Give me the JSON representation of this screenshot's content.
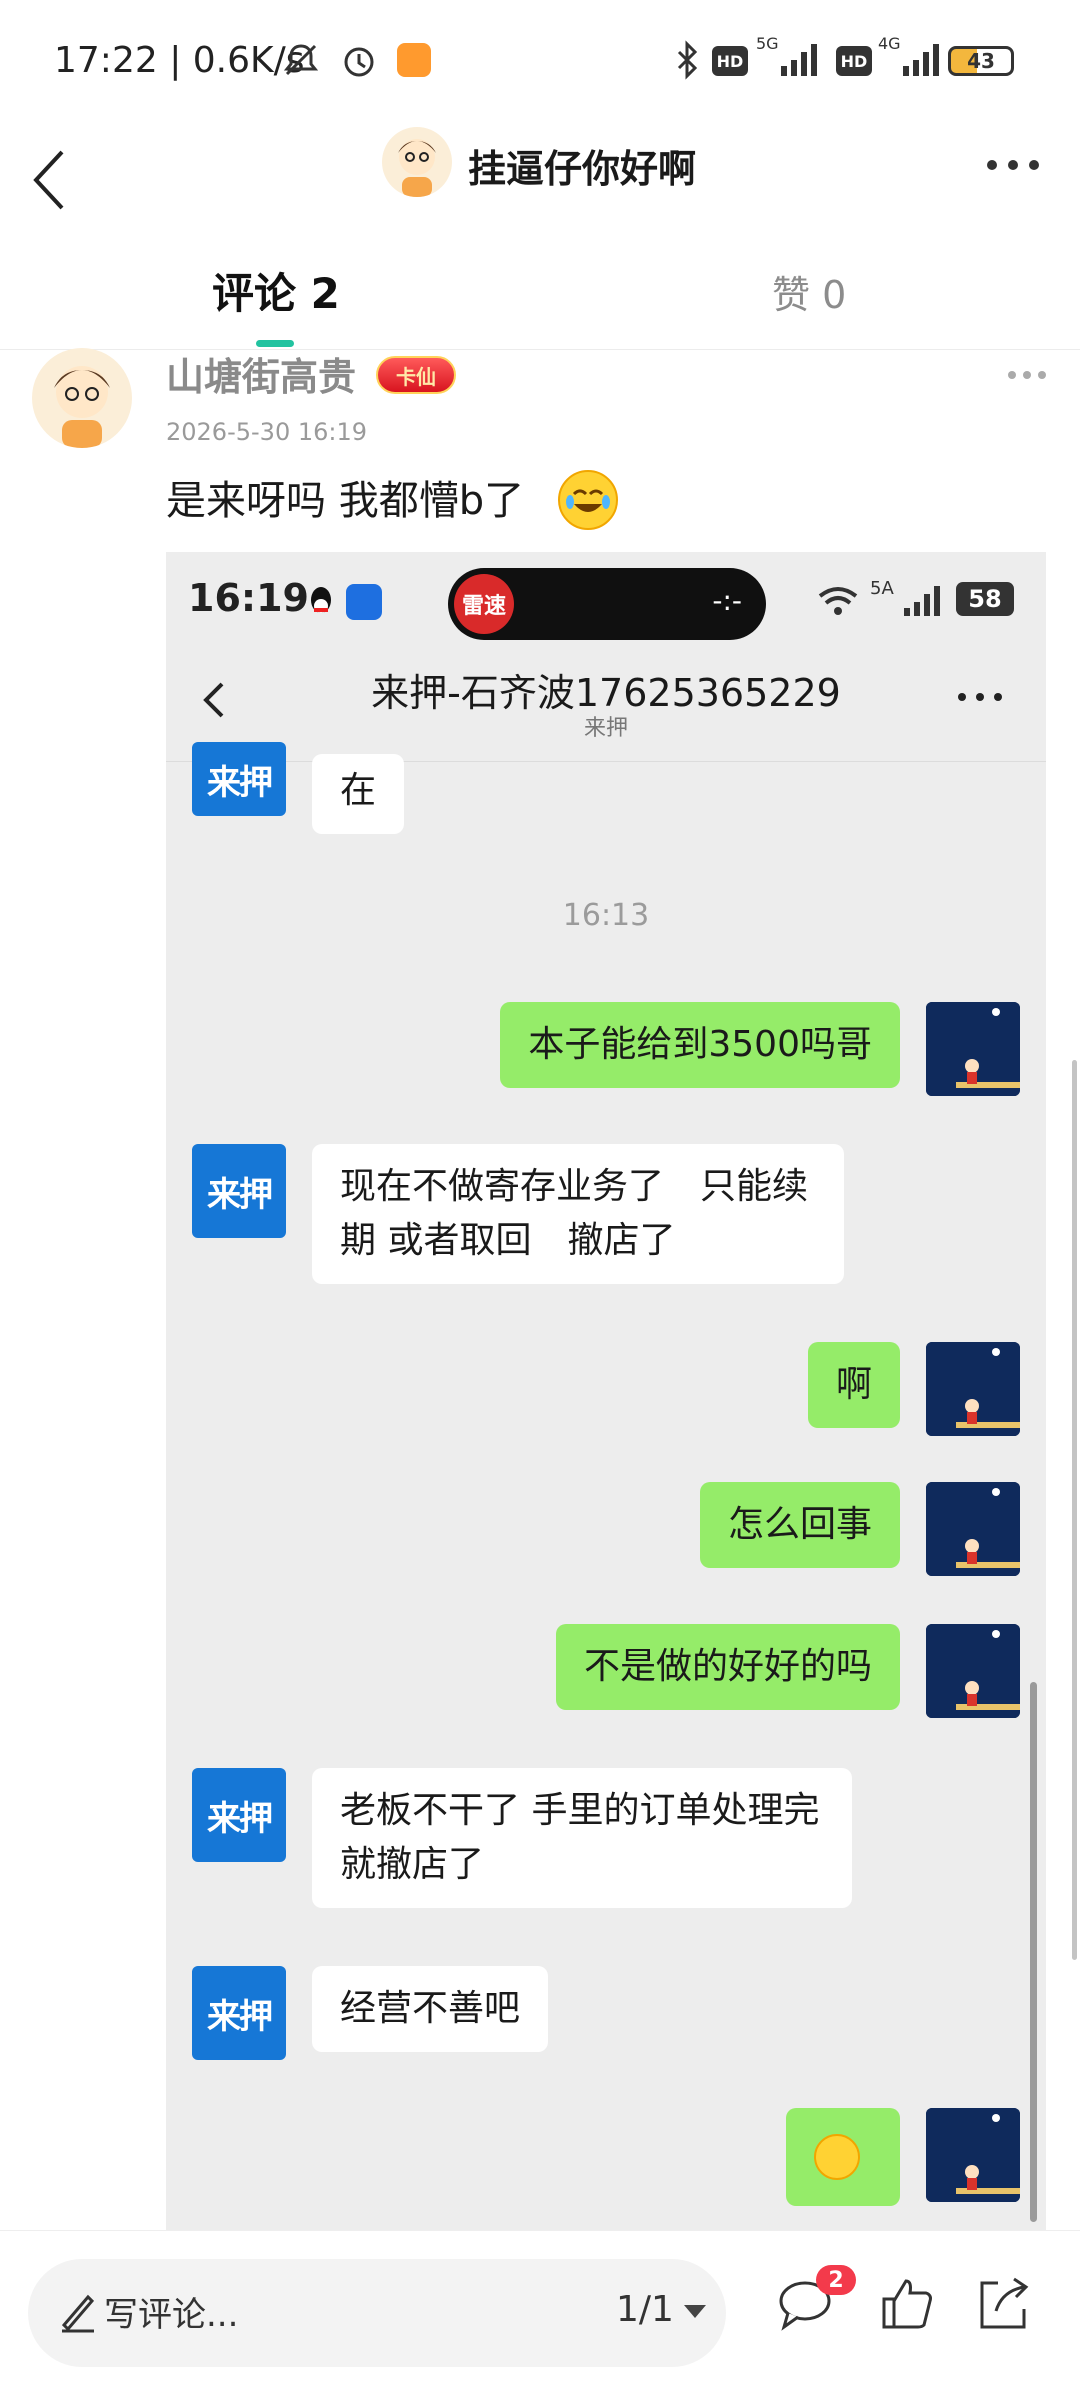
{
  "status_bar": {
    "time": "17:22 | 0.6K/s",
    "battery": "43",
    "net_5g": "5G",
    "net_4g": "4G",
    "hd1": "HD",
    "hd2": "HD"
  },
  "header": {
    "title": "挂逼仔你好啊"
  },
  "tabs": {
    "comments": "评论 2",
    "likes": "赞 0"
  },
  "comment": {
    "username": "山塘街高贵",
    "badge": "卡仙",
    "date": "2026-5-30 16:19",
    "text": "是来呀吗 我都懵b了"
  },
  "screenshot": {
    "status_time": "16:19",
    "island_badge": "雷速",
    "island_text": "-:-",
    "net": "5A",
    "battery": "58",
    "title": "来押-石齐波17625365229",
    "subtitle": "来押",
    "avatar_left_label": "来押",
    "messages": [
      {
        "side": "left",
        "text": "在"
      },
      {
        "side": "time",
        "text": "16:13"
      },
      {
        "side": "right",
        "text": "本子能给到3500吗哥"
      },
      {
        "side": "left",
        "text": "现在不做寄存业务了　只能续期 或者取回　撤店了"
      },
      {
        "side": "right",
        "text": "啊"
      },
      {
        "side": "right",
        "text": "怎么回事"
      },
      {
        "side": "right",
        "text": "不是做的好好的吗"
      },
      {
        "side": "left",
        "text": "老板不干了 手里的订单处理完就撤店了"
      },
      {
        "side": "left",
        "text": "经营不善吧"
      },
      {
        "side": "right",
        "text": ""
      }
    ]
  },
  "bottom_bar": {
    "input_placeholder": "写评论...",
    "pager": "1/1",
    "comment_count_badge": "2"
  },
  "colors": {
    "accent": "#22c3a0",
    "bubble_right": "#95ec69",
    "bubble_left": "#ffffff",
    "chat_bg": "#ededed",
    "badge_red": "#f33a4b"
  }
}
